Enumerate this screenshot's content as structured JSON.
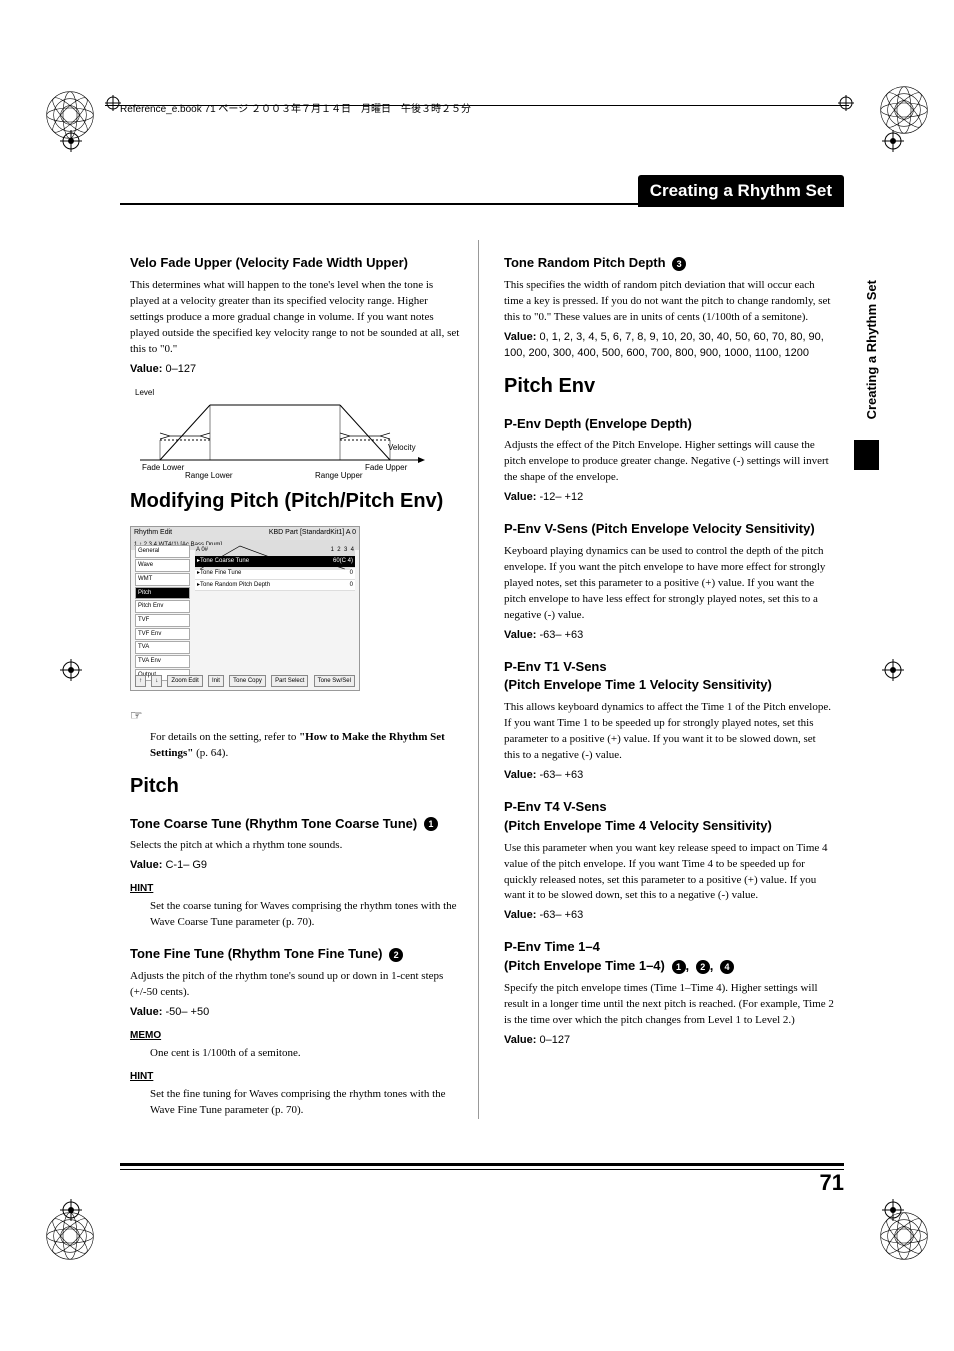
{
  "header": "Reference_e.book 71 ページ ２００３年７月１４日　月曜日　午後３時２５分",
  "page_title": "Creating a Rhythm Set",
  "side_tab": "Creating a Rhythm Set",
  "page_number": "71",
  "left": {
    "velo_fade_upper": {
      "heading": "Velo Fade Upper (Velocity Fade Width Upper)",
      "body": "This determines what will happen to the tone's level when the tone is played at a velocity greater than its specified velocity range. Higher settings produce a more gradual change in volume. If you want notes played outside the specified key velocity range to not be sounded at all, set this to \"0.\"",
      "value_label": "Value:",
      "value": "0–127",
      "diagram": {
        "level": "Level",
        "velocity": "Velocity",
        "fade_lower": "Fade Lower",
        "range_lower": "Range Lower",
        "fade_upper": "Fade Upper",
        "range_upper": "Range Upper"
      }
    },
    "modifying_pitch_heading": "Modifying Pitch (Pitch/Pitch Env)",
    "screenshot": {
      "title_left": "Rhythm Edit",
      "title_right": "KBD Part    [StandardKit1] A 0",
      "tab_row": "1 ↕ 2   3   4   WT4(1)  [Ac.Bass Drum]",
      "top_bar": "A  0#",
      "menu": [
        "General",
        "Wave",
        "WMT",
        "Pitch",
        "Pitch Env",
        "TVF",
        "TVF Env",
        "TVA",
        "TVA Env",
        "Output"
      ],
      "params": [
        {
          "name": "Tone Coarse Tune",
          "val": "60(C 4)"
        },
        {
          "name": "Tone Fine Tune",
          "val": "0"
        },
        {
          "name": "Tone Random Pitch Depth",
          "val": "0"
        }
      ],
      "bottom": [
        "↑",
        "↓",
        "Zoom Edit",
        "Init",
        "Tone Copy",
        "Part Select",
        "Tone Sw/Sel"
      ]
    },
    "ref_note": {
      "prefix": "For details on the setting, refer to ",
      "bold": "\"How to Make the Rhythm Set Settings\"",
      "suffix": " (p. 64)."
    },
    "pitch_heading": "Pitch",
    "tone_coarse": {
      "heading": "Tone Coarse Tune (Rhythm Tone Coarse Tune)",
      "num": "1",
      "body": "Selects the pitch at which a rhythm tone sounds.",
      "value_label": "Value:",
      "value": "C-1– G9",
      "hint_label": "HINT",
      "hint_body": "Set the coarse tuning for Waves comprising the rhythm tones with the Wave Coarse Tune parameter (p. 70)."
    },
    "tone_fine": {
      "heading": "Tone Fine Tune (Rhythm Tone Fine Tune)",
      "num": "2",
      "body": "Adjusts the pitch of the rhythm tone's sound up or down in 1-cent steps (+/-50 cents).",
      "value_label": "Value:",
      "value": "-50– +50",
      "memo_label": "MEMO",
      "memo_body": "One cent is 1/100th of a semitone.",
      "hint_label": "HINT",
      "hint_body": "Set the fine tuning for Waves comprising the rhythm tones with the Wave Fine Tune parameter (p. 70)."
    }
  },
  "right": {
    "tone_random": {
      "heading": "Tone Random Pitch Depth",
      "num": "3",
      "body": "This specifies the width of random pitch deviation that will occur each time a key is pressed. If you do not want the pitch to change randomly, set this to \"0.\" These values are in units of cents (1/100th of a semitone).",
      "value_label": "Value:",
      "value": "0, 1, 2, 3, 4, 5, 6, 7, 8, 9, 10, 20, 30, 40, 50, 60, 70, 80, 90, 100, 200, 300, 400, 500, 600, 700, 800, 900, 1000, 1100, 1200"
    },
    "pitch_env_heading": "Pitch Env",
    "penv_depth": {
      "heading": "P-Env Depth (Envelope Depth)",
      "body": "Adjusts the effect of the Pitch Envelope. Higher settings will cause the pitch envelope to produce greater change. Negative (-) settings will invert the shape of the envelope.",
      "value_label": "Value:",
      "value": "-12– +12"
    },
    "penv_vsens": {
      "heading": "P-Env V-Sens (Pitch Envelope Velocity Sensitivity)",
      "body": "Keyboard playing dynamics can be used to control the depth of the pitch envelope. If you want the pitch envelope to have more effect for strongly played notes, set this parameter to a positive (+) value. If you want the pitch envelope to have less effect for strongly played notes, set this to a negative (-) value.",
      "value_label": "Value:",
      "value": "-63– +63"
    },
    "penv_t1": {
      "heading_l1": "P-Env T1 V-Sens",
      "heading_l2": "(Pitch Envelope Time 1 Velocity Sensitivity)",
      "body": "This allows keyboard dynamics to affect the Time 1 of the Pitch envelope. If you want Time 1 to be speeded up for strongly played notes, set this parameter to a positive (+) value. If you want it to be slowed down, set this to a negative (-) value.",
      "value_label": "Value:",
      "value": "-63– +63"
    },
    "penv_t4": {
      "heading_l1": "P-Env T4 V-Sens",
      "heading_l2": "(Pitch Envelope Time 4 Velocity Sensitivity)",
      "body": "Use this parameter when you want key release speed to impact on Time 4 value of the pitch envelope. If you want Time 4 to be speeded up for quickly released notes, set this parameter to a positive (+) value. If you want it to be slowed down, set this to a negative (-) value.",
      "value_label": "Value:",
      "value": "-63– +63"
    },
    "penv_time": {
      "heading_l1": "P-Env Time 1–4",
      "heading_l2": "(Pitch Envelope Time 1–4)",
      "nums": [
        "1",
        "2",
        "4"
      ],
      "sep": ", ",
      "body": "Specify the pitch envelope times (Time 1–Time 4). Higher settings will result in a longer time until the next pitch is reached. (For example, Time 2 is the time over which the pitch changes from Level 1 to Level 2.)",
      "value_label": "Value:",
      "value": "0–127"
    }
  }
}
